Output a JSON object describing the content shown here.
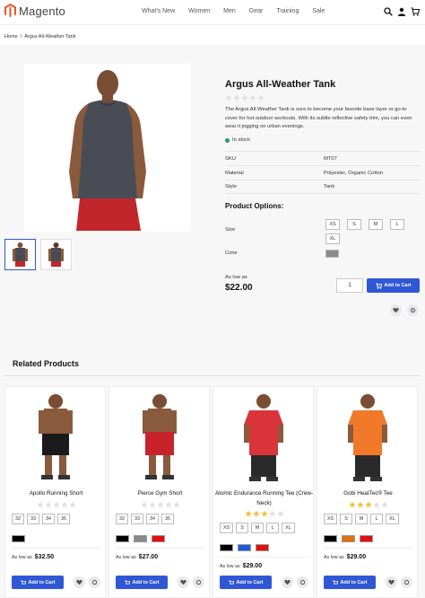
{
  "header": {
    "logo_text": "Magento",
    "nav": [
      "What's New",
      "Women",
      "Men",
      "Gear",
      "Training",
      "Sale"
    ]
  },
  "breadcrumb": {
    "home": "Home",
    "sep": "/",
    "current": "Argus All-Weather Tank"
  },
  "product": {
    "title": "Argus All-Weather Tank",
    "rating_stars": 0,
    "description": "The Argus All-Weather Tank is sure to become your favorite base layer or go-to cover for hot outdoor workouts. With its subtle reflective safety trim, you can even wear it jogging on urban evenings.",
    "stock": "In stock",
    "attributes": [
      {
        "label": "SKU",
        "value": "MT07"
      },
      {
        "label": "Material",
        "value": "Polyester, Organic Cotton"
      },
      {
        "label": "Style",
        "value": "Tank"
      }
    ],
    "options_title": "Product Options:",
    "size_label": "Size",
    "sizes": [
      "XS",
      "S",
      "M",
      "L",
      "XL"
    ],
    "color_label": "Color",
    "colors": [
      "#8a8a8a"
    ],
    "as_low_as": "As low as",
    "price": "$22.00",
    "qty": "1",
    "add_to_cart": "Add to Cart"
  },
  "related": {
    "title": "Related Products",
    "items": [
      {
        "name": "Apollo Running Short",
        "stars": 0,
        "sizes": [
          "32",
          "33",
          "34",
          "36"
        ],
        "colors": [
          "#000000"
        ],
        "as_low_as": "As low as",
        "price": "$32.50",
        "add": "Add to Cart"
      },
      {
        "name": "Pierce Gym Short",
        "stars": 0,
        "sizes": [
          "32",
          "33",
          "34",
          "36"
        ],
        "colors": [
          "#000000",
          "#8a8a8a",
          "#e01010"
        ],
        "as_low_as": "As low as",
        "price": "$27.00",
        "add": "Add to Cart"
      },
      {
        "name": "Atomic Endurance Running Tee (Crew-Neck)",
        "stars": 3,
        "sizes": [
          "XS",
          "S",
          "M",
          "L",
          "XL"
        ],
        "colors": [
          "#000000",
          "#1f5ad6",
          "#e01010"
        ],
        "as_low_as": "As low as",
        "price": "$29.00",
        "add": "Add to Cart"
      },
      {
        "name": "Gobi HeatTec® Tee",
        "stars": 3,
        "sizes": [
          "XS",
          "S",
          "M",
          "L",
          "XL"
        ],
        "colors": [
          "#000000",
          "#e07010",
          "#e01010"
        ],
        "as_low_as": "As low as",
        "price": "$29.00",
        "add": "Add to Cart"
      }
    ]
  },
  "colors": {
    "accent": "#2f57d6",
    "star_on": "#f1c23a",
    "star_off": "#e0e0e4",
    "stock_dot": "#2b9b6a"
  }
}
